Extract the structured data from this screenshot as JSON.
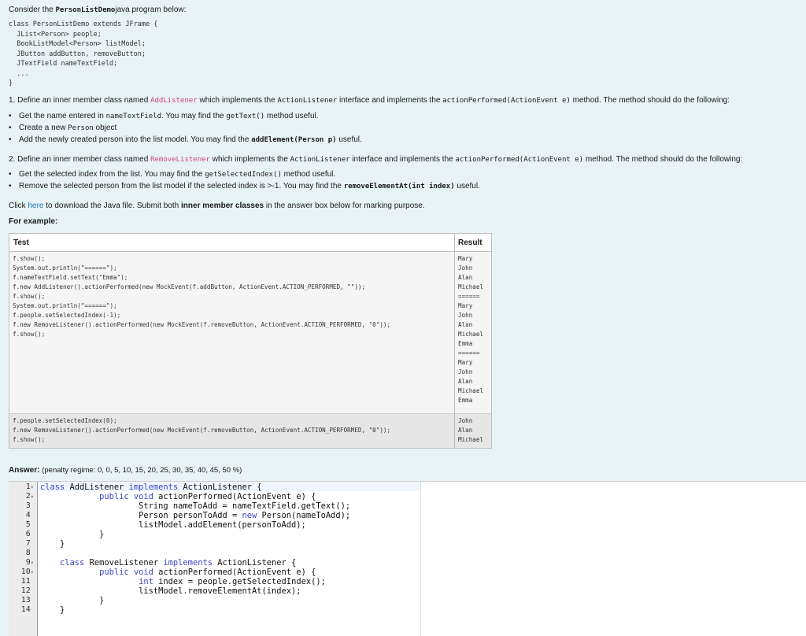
{
  "intro": {
    "prefix": "Consider the ",
    "program": "PersonListDemo",
    "suffix": "java program below:"
  },
  "given_code": "class PersonListDemo extends JFrame {\n  JList<Person> people;\n  BookListModel<Person> listModel;\n  JButton addButton, removeButton;\n  JTextField nameTextField;\n  ...\n}",
  "part1": {
    "a": "1. Define an inner member class named ",
    "cls": "AddListener",
    "b": " which implements the ",
    "iface": "ActionListener",
    "c": " interface and implements the ",
    "method": "actionPerformed(ActionEvent e)",
    "d": " method. The method should do the following:",
    "b1a": "Get the name entered in ",
    "b1code": "nameTextField",
    "b1b": ". You may find the ",
    "b1code2": "getText()",
    "b1c": " method useful.",
    "b2a": "Create a new ",
    "b2code": "Person",
    "b2b": " object",
    "b3a": "Add the newly created person into the list model. You may find the ",
    "b3code": "addElement(Person p)",
    "b3b": " useful."
  },
  "part2": {
    "a": "2. Define an inner member class named ",
    "cls": "RemoveListener",
    "b": " which implements the ",
    "iface": "ActionListener",
    "c": " interface and implements the ",
    "method": "actionPerformed(ActionEvent e)",
    "d": " method. The method should do the following:",
    "b1a": "Get the selected index from the list. You may find the ",
    "b1code": "getSelectedIndex()",
    "b1b": " method useful.",
    "b2a": "Remove the selected person from the list model if the selected index is >-1. You may find the ",
    "b2code": "removeElementAt(int index)",
    "b2b": " useful."
  },
  "download": {
    "a": "Click ",
    "link": "here",
    "b": " to download the Java file. Submit both ",
    "bold": "inner member classes",
    "c": " in the answer box below for marking purpose."
  },
  "for_example": "For example:",
  "table": {
    "header_test": "Test",
    "header_result": "Result",
    "rows": [
      {
        "test": "f.show();\nSystem.out.println(\"======\");\nf.nameTextField.setText(\"Emma\");\nf.new AddListener().actionPerformed(new MockEvent(f.addButton, ActionEvent.ACTION_PERFORMED, \"\"));\nf.show();\nSystem.out.println(\"======\");\nf.people.setSelectedIndex(-1);\nf.new RemoveListener().actionPerformed(new MockEvent(f.removeButton, ActionEvent.ACTION_PERFORMED, \"0\"));\nf.show();",
        "result": "Mary\nJohn\nAlan\nMichael\n======\nMary\nJohn\nAlan\nMichael\nEmma\n======\nMary\nJohn\nAlan\nMichael\nEmma"
      },
      {
        "test": "f.people.setSelectedIndex(0);\nf.new RemoveListener().actionPerformed(new MockEvent(f.removeButton, ActionEvent.ACTION_PERFORMED, \"0\"));\nf.show();",
        "result": "John\nAlan\nMichael"
      }
    ]
  },
  "answer": {
    "label": "Answer:",
    "penalty": "(penalty regime: 0, 0, 5, 10, 15, 20, 25, 30, 35, 40, 45, 50 %)",
    "line_numbers": [
      "1",
      "2",
      "3",
      "4",
      "5",
      "6",
      "7",
      "8",
      "9",
      "10",
      "11",
      "12",
      "13",
      "14"
    ],
    "fold_lines": [
      "1",
      "2",
      "9",
      "10"
    ],
    "code_lines": [
      [
        [
          "k",
          "class"
        ],
        [
          "t",
          " AddListener "
        ],
        [
          "k",
          "implements"
        ],
        [
          "t",
          " ActionListener {"
        ]
      ],
      [
        [
          "t",
          "            "
        ],
        [
          "k",
          "public void"
        ],
        [
          "t",
          " actionPerformed(ActionEvent e) {"
        ]
      ],
      [
        [
          "t",
          "                    String nameToAdd = nameTextField.getText();"
        ]
      ],
      [
        [
          "t",
          "                    Person personToAdd = "
        ],
        [
          "k",
          "new"
        ],
        [
          "t",
          " Person(nameToAdd);"
        ]
      ],
      [
        [
          "t",
          "                    listModel.addElement(personToAdd);"
        ]
      ],
      [
        [
          "t",
          "            }"
        ]
      ],
      [
        [
          "t",
          "    }"
        ]
      ],
      [
        [
          "t",
          ""
        ]
      ],
      [
        [
          "t",
          "    "
        ],
        [
          "k",
          "class"
        ],
        [
          "t",
          " RemoveListener "
        ],
        [
          "k",
          "implements"
        ],
        [
          "t",
          " ActionListener {"
        ]
      ],
      [
        [
          "t",
          "            "
        ],
        [
          "k",
          "public void"
        ],
        [
          "t",
          " actionPerformed(ActionEvent e) {"
        ]
      ],
      [
        [
          "t",
          "                    "
        ],
        [
          "k",
          "int"
        ],
        [
          "t",
          " index = people.getSelectedIndex();"
        ]
      ],
      [
        [
          "t",
          "                    listModel.removeElementAt(index);"
        ]
      ],
      [
        [
          "t",
          "            }"
        ]
      ],
      [
        [
          "t",
          "    }"
        ]
      ]
    ]
  }
}
